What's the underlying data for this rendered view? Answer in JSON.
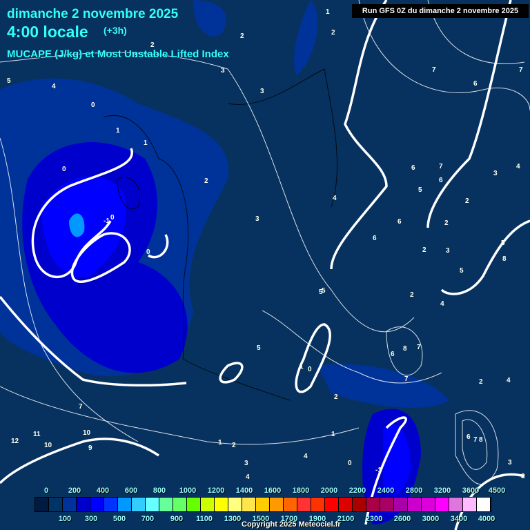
{
  "header": {
    "date": "dimanche 2 novembre 2025",
    "hour": "4:00 locale",
    "offset": "(+3h)",
    "parameter": "MUCAPE (J/kg) et Most Unstable Lifted Index",
    "run": "Run GFS 0Z du dimanche 2 novembre 2025"
  },
  "legend": {
    "colors": [
      "#001a40",
      "#003366",
      "#003399",
      "#0000cc",
      "#0000ff",
      "#0033ff",
      "#0099ff",
      "#33ccff",
      "#66ffff",
      "#66ff99",
      "#66ff66",
      "#66ff00",
      "#ccff00",
      "#ffff00",
      "#ffff80",
      "#ffe64d",
      "#ffcc00",
      "#ff9900",
      "#ff6600",
      "#ff3333",
      "#ff3300",
      "#ff0000",
      "#dd0000",
      "#aa0000",
      "#aa0044",
      "#aa0066",
      "#aa00aa",
      "#cc00cc",
      "#dd00dd",
      "#ff00ff",
      "#dd77dd",
      "#ffbbff",
      "#ffffff"
    ],
    "top_labels": [
      "0",
      "200",
      "400",
      "600",
      "800",
      "1000",
      "1200",
      "1400",
      "1600",
      "1800",
      "2000",
      "2200",
      "2400",
      "2800",
      "3200",
      "3600",
      "4500"
    ],
    "bottom_labels": [
      "100",
      "300",
      "500",
      "700",
      "900",
      "1100",
      "1300",
      "1500",
      "1700",
      "1900",
      "2100",
      "2300",
      "2600",
      "3000",
      "3400",
      "4000"
    ]
  },
  "contour_labels": [
    "1",
    "2",
    "2",
    "2",
    "2",
    "3",
    "3",
    "5",
    "4",
    "0",
    "1",
    "0",
    "1",
    "2",
    "-1",
    "0",
    "0",
    "3",
    "4",
    "7",
    "6",
    "6",
    "7",
    "5",
    "6",
    "2",
    "6",
    "2",
    "3",
    "5",
    "2",
    "5",
    "4",
    "2",
    "3",
    "4",
    "5",
    "6",
    "8",
    "7",
    "7",
    "0",
    "1",
    "2",
    "5",
    "6",
    "8",
    "7",
    "10",
    "9",
    "11",
    "12",
    "10",
    "7",
    "4",
    "1",
    "2",
    "3",
    "4",
    "0",
    "-1",
    "1",
    "2",
    "5",
    "6",
    "7",
    "8",
    "4",
    "3",
    "2"
  ],
  "copyright": "Copyright 2025 Meteociel.fr"
}
